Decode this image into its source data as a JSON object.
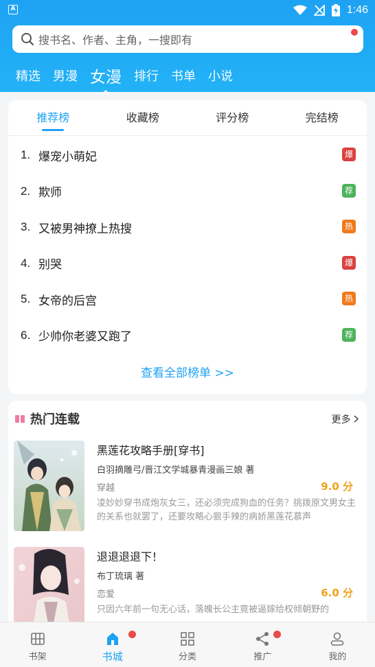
{
  "status": {
    "time": "1:46"
  },
  "search": {
    "placeholder": "搜书名、作者、主角，一搜即有"
  },
  "nav": [
    {
      "label": "精选"
    },
    {
      "label": "男漫"
    },
    {
      "label": "女漫",
      "active": true
    },
    {
      "label": "排行"
    },
    {
      "label": "书单"
    },
    {
      "label": "小说"
    }
  ],
  "rank": {
    "tabs": [
      {
        "label": "推荐榜",
        "active": true
      },
      {
        "label": "收藏榜"
      },
      {
        "label": "评分榜"
      },
      {
        "label": "完结榜"
      }
    ],
    "items": [
      {
        "num": "1.",
        "title": "爆宠小萌妃",
        "badge": "爆",
        "badge_color": "#d9423f"
      },
      {
        "num": "2.",
        "title": "欺师",
        "badge": "荐",
        "badge_color": "#4cb35a"
      },
      {
        "num": "3.",
        "title": "又被男神撩上热搜",
        "badge": "热",
        "badge_color": "#f07a1a"
      },
      {
        "num": "4.",
        "title": "别哭",
        "badge": "爆",
        "badge_color": "#d9423f"
      },
      {
        "num": "5.",
        "title": "女帝的后宫",
        "badge": "热",
        "badge_color": "#f07a1a"
      },
      {
        "num": "6.",
        "title": "少帅你老婆又跑了",
        "badge": "荐",
        "badge_color": "#4cb35a"
      }
    ],
    "view_all": "查看全部榜单 >>"
  },
  "hot": {
    "title": "热门连载",
    "more": "更多",
    "books": [
      {
        "title": "黑莲花攻略手册[穿书]",
        "author": "白羽摘雕弓/晋江文学城暴青漫画三娘 著",
        "tag": "穿越",
        "score": "9.0 分",
        "desc": "凌妙妙穿书成炮灰女三，还必须完成狗血的任务？挑拨原文男女主的关系也就罢了，还要攻略心狠手辣的病娇黑莲花慕声"
      },
      {
        "title": "退退退退下！",
        "author": "布丁琉璃 著",
        "tag": "恋爱",
        "score": "6.0 分",
        "desc": "只因六年前一句无心话，落魄长公主竟被逼嫁给权倾朝野的"
      }
    ]
  },
  "tabbar": [
    {
      "label": "书架",
      "icon": "bookshelf-icon"
    },
    {
      "label": "书城",
      "icon": "home-icon",
      "active": true,
      "dot": true
    },
    {
      "label": "分类",
      "icon": "grid-icon"
    },
    {
      "label": "推广",
      "icon": "share-icon",
      "dot": true
    },
    {
      "label": "我的",
      "icon": "user-icon"
    }
  ],
  "colors": {
    "primary": "#1ea2f3",
    "score": "#f0a21a",
    "dot": "#e94a4a"
  }
}
